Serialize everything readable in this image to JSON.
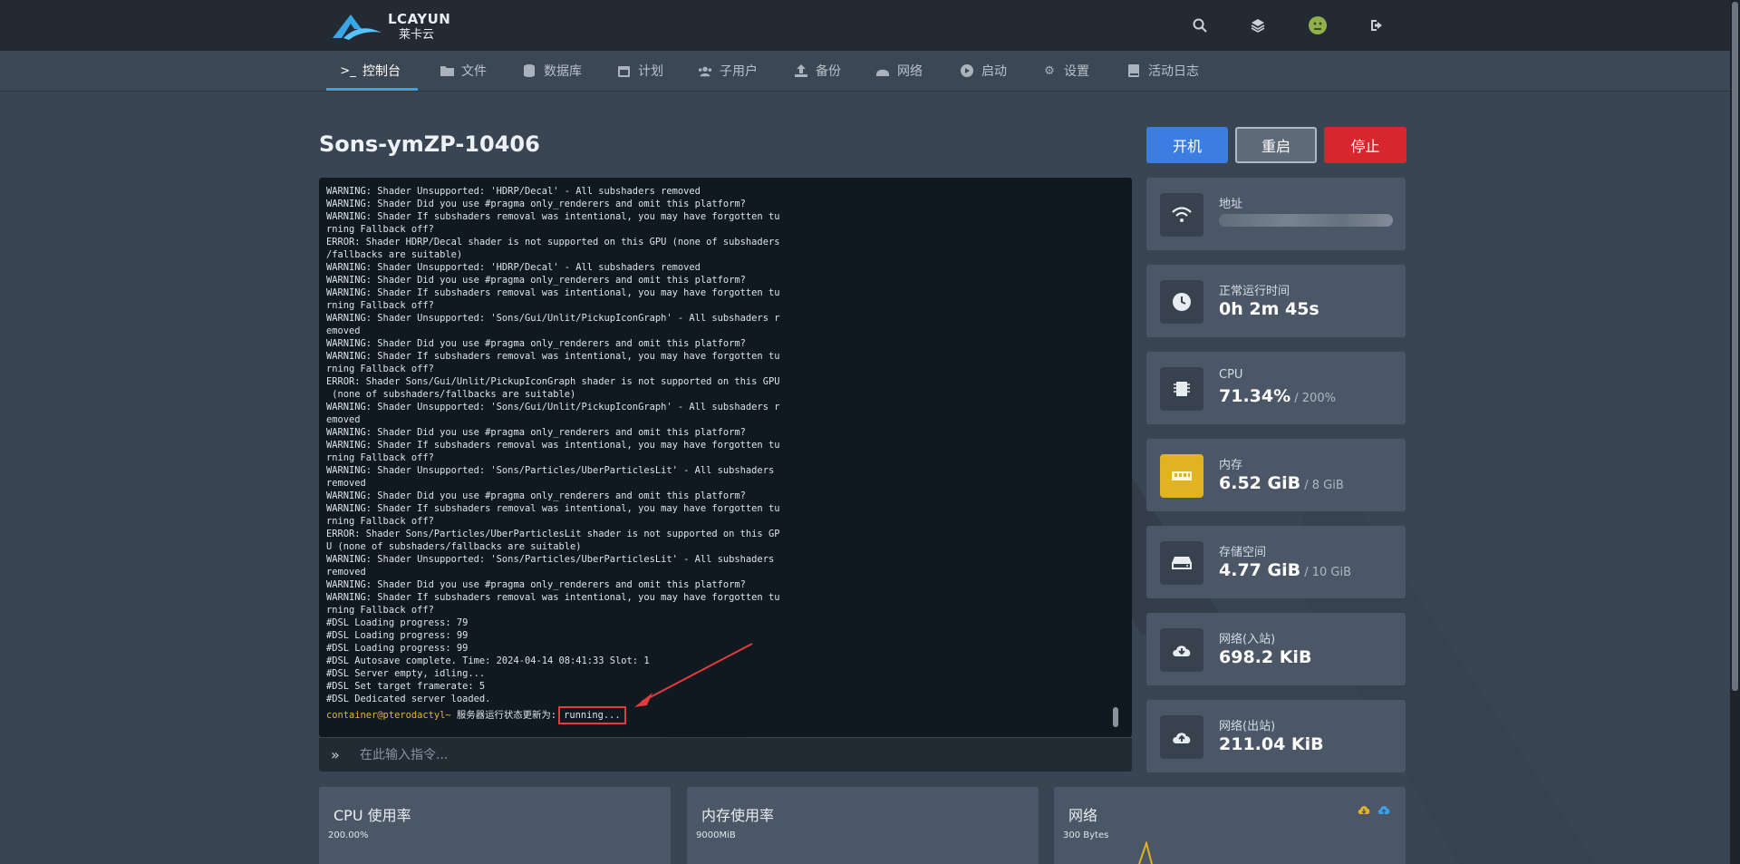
{
  "brand": {
    "logo_latin": "LCAYUN",
    "logo_chinese": "莱卡云"
  },
  "topbar": {
    "icons": [
      "search-icon",
      "layers-icon",
      "avatar",
      "logout-icon"
    ]
  },
  "nav": {
    "items": [
      {
        "label": "控制台",
        "icon": "terminal-icon",
        "active": true
      },
      {
        "label": "文件",
        "icon": "folder-icon"
      },
      {
        "label": "数据库",
        "icon": "database-icon"
      },
      {
        "label": "计划",
        "icon": "calendar-icon"
      },
      {
        "label": "子用户",
        "icon": "users-icon"
      },
      {
        "label": "备份",
        "icon": "upload-icon"
      },
      {
        "label": "网络",
        "icon": "network-icon"
      },
      {
        "label": "启动",
        "icon": "play-icon"
      },
      {
        "label": "设置",
        "icon": "gear-icon"
      },
      {
        "label": "活动日志",
        "icon": "book-icon"
      }
    ]
  },
  "server": {
    "name": "Sons-ymZP-10406"
  },
  "power": {
    "start": "开机",
    "restart": "重启",
    "stop": "停止"
  },
  "console": {
    "lines": [
      "WARNING: Shader Unsupported: 'HDRP/Decal' - All subshaders removed",
      "WARNING: Shader Did you use #pragma only_renderers and omit this platform?",
      "WARNING: Shader If subshaders removal was intentional, you may have forgotten tu",
      "rning Fallback off?",
      "ERROR: Shader HDRP/Decal shader is not supported on this GPU (none of subshaders",
      "/fallbacks are suitable)",
      "WARNING: Shader Unsupported: 'HDRP/Decal' - All subshaders removed",
      "WARNING: Shader Did you use #pragma only_renderers and omit this platform?",
      "WARNING: Shader If subshaders removal was intentional, you may have forgotten tu",
      "rning Fallback off?",
      "WARNING: Shader Unsupported: 'Sons/Gui/Unlit/PickupIconGraph' - All subshaders r",
      "emoved",
      "WARNING: Shader Did you use #pragma only_renderers and omit this platform?",
      "WARNING: Shader If subshaders removal was intentional, you may have forgotten tu",
      "rning Fallback off?",
      "ERROR: Shader Sons/Gui/Unlit/PickupIconGraph shader is not supported on this GPU",
      " (none of subshaders/fallbacks are suitable)",
      "WARNING: Shader Unsupported: 'Sons/Gui/Unlit/PickupIconGraph' - All subshaders r",
      "emoved",
      "WARNING: Shader Did you use #pragma only_renderers and omit this platform?",
      "WARNING: Shader If subshaders removal was intentional, you may have forgotten tu",
      "rning Fallback off?",
      "WARNING: Shader Unsupported: 'Sons/Particles/UberParticlesLit' - All subshaders",
      "removed",
      "WARNING: Shader Did you use #pragma only_renderers and omit this platform?",
      "WARNING: Shader If subshaders removal was intentional, you may have forgotten tu",
      "rning Fallback off?",
      "ERROR: Shader Sons/Particles/UberParticlesLit shader is not supported on this GP",
      "U (none of subshaders/fallbacks are suitable)",
      "WARNING: Shader Unsupported: 'Sons/Particles/UberParticlesLit' - All subshaders",
      "removed",
      "WARNING: Shader Did you use #pragma only_renderers and omit this platform?",
      "WARNING: Shader If subshaders removal was intentional, you may have forgotten tu",
      "rning Fallback off?",
      "#DSL Loading progress: 79",
      "#DSL Loading progress: 99",
      "#DSL Loading progress: 99",
      "#DSL Autosave complete. Time: 2024-04-14 08:41:33 Slot: 1",
      "#DSL Server empty, idling...",
      "#DSL Set target framerate: 5",
      "#DSL Dedicated server loaded."
    ],
    "prompt_user": "container@pterodactyl~",
    "prompt_message": " 服务器运行状态更新为:",
    "status": "running...",
    "input_placeholder": "在此输入指令..."
  },
  "stats": {
    "address": {
      "label": "地址"
    },
    "uptime": {
      "label": "正常运行时间",
      "value": "0h 2m 45s"
    },
    "cpu": {
      "label": "CPU",
      "value": "71.34%",
      "limit": " / 200%"
    },
    "memory": {
      "label": "内存",
      "value": "6.52 GiB",
      "limit": " / 8 GiB"
    },
    "disk": {
      "label": "存储空间",
      "value": "4.77 GiB",
      "limit": " / 10 GiB"
    },
    "net_in": {
      "label": "网络(入站)",
      "value": "698.2 KiB"
    },
    "net_out": {
      "label": "网络(出站)",
      "value": "211.04 KiB"
    }
  },
  "panels": {
    "cpu": {
      "title": "CPU 使用率",
      "max": "200.00%"
    },
    "memory": {
      "title": "内存使用率",
      "max": "9000MiB"
    },
    "network": {
      "title": "网络",
      "max": "300 Bytes"
    }
  },
  "colors": {
    "accent": "#3ba1e8",
    "start": "#3b7de0",
    "stop": "#d7262e",
    "warning_icon": "#e2b320"
  }
}
